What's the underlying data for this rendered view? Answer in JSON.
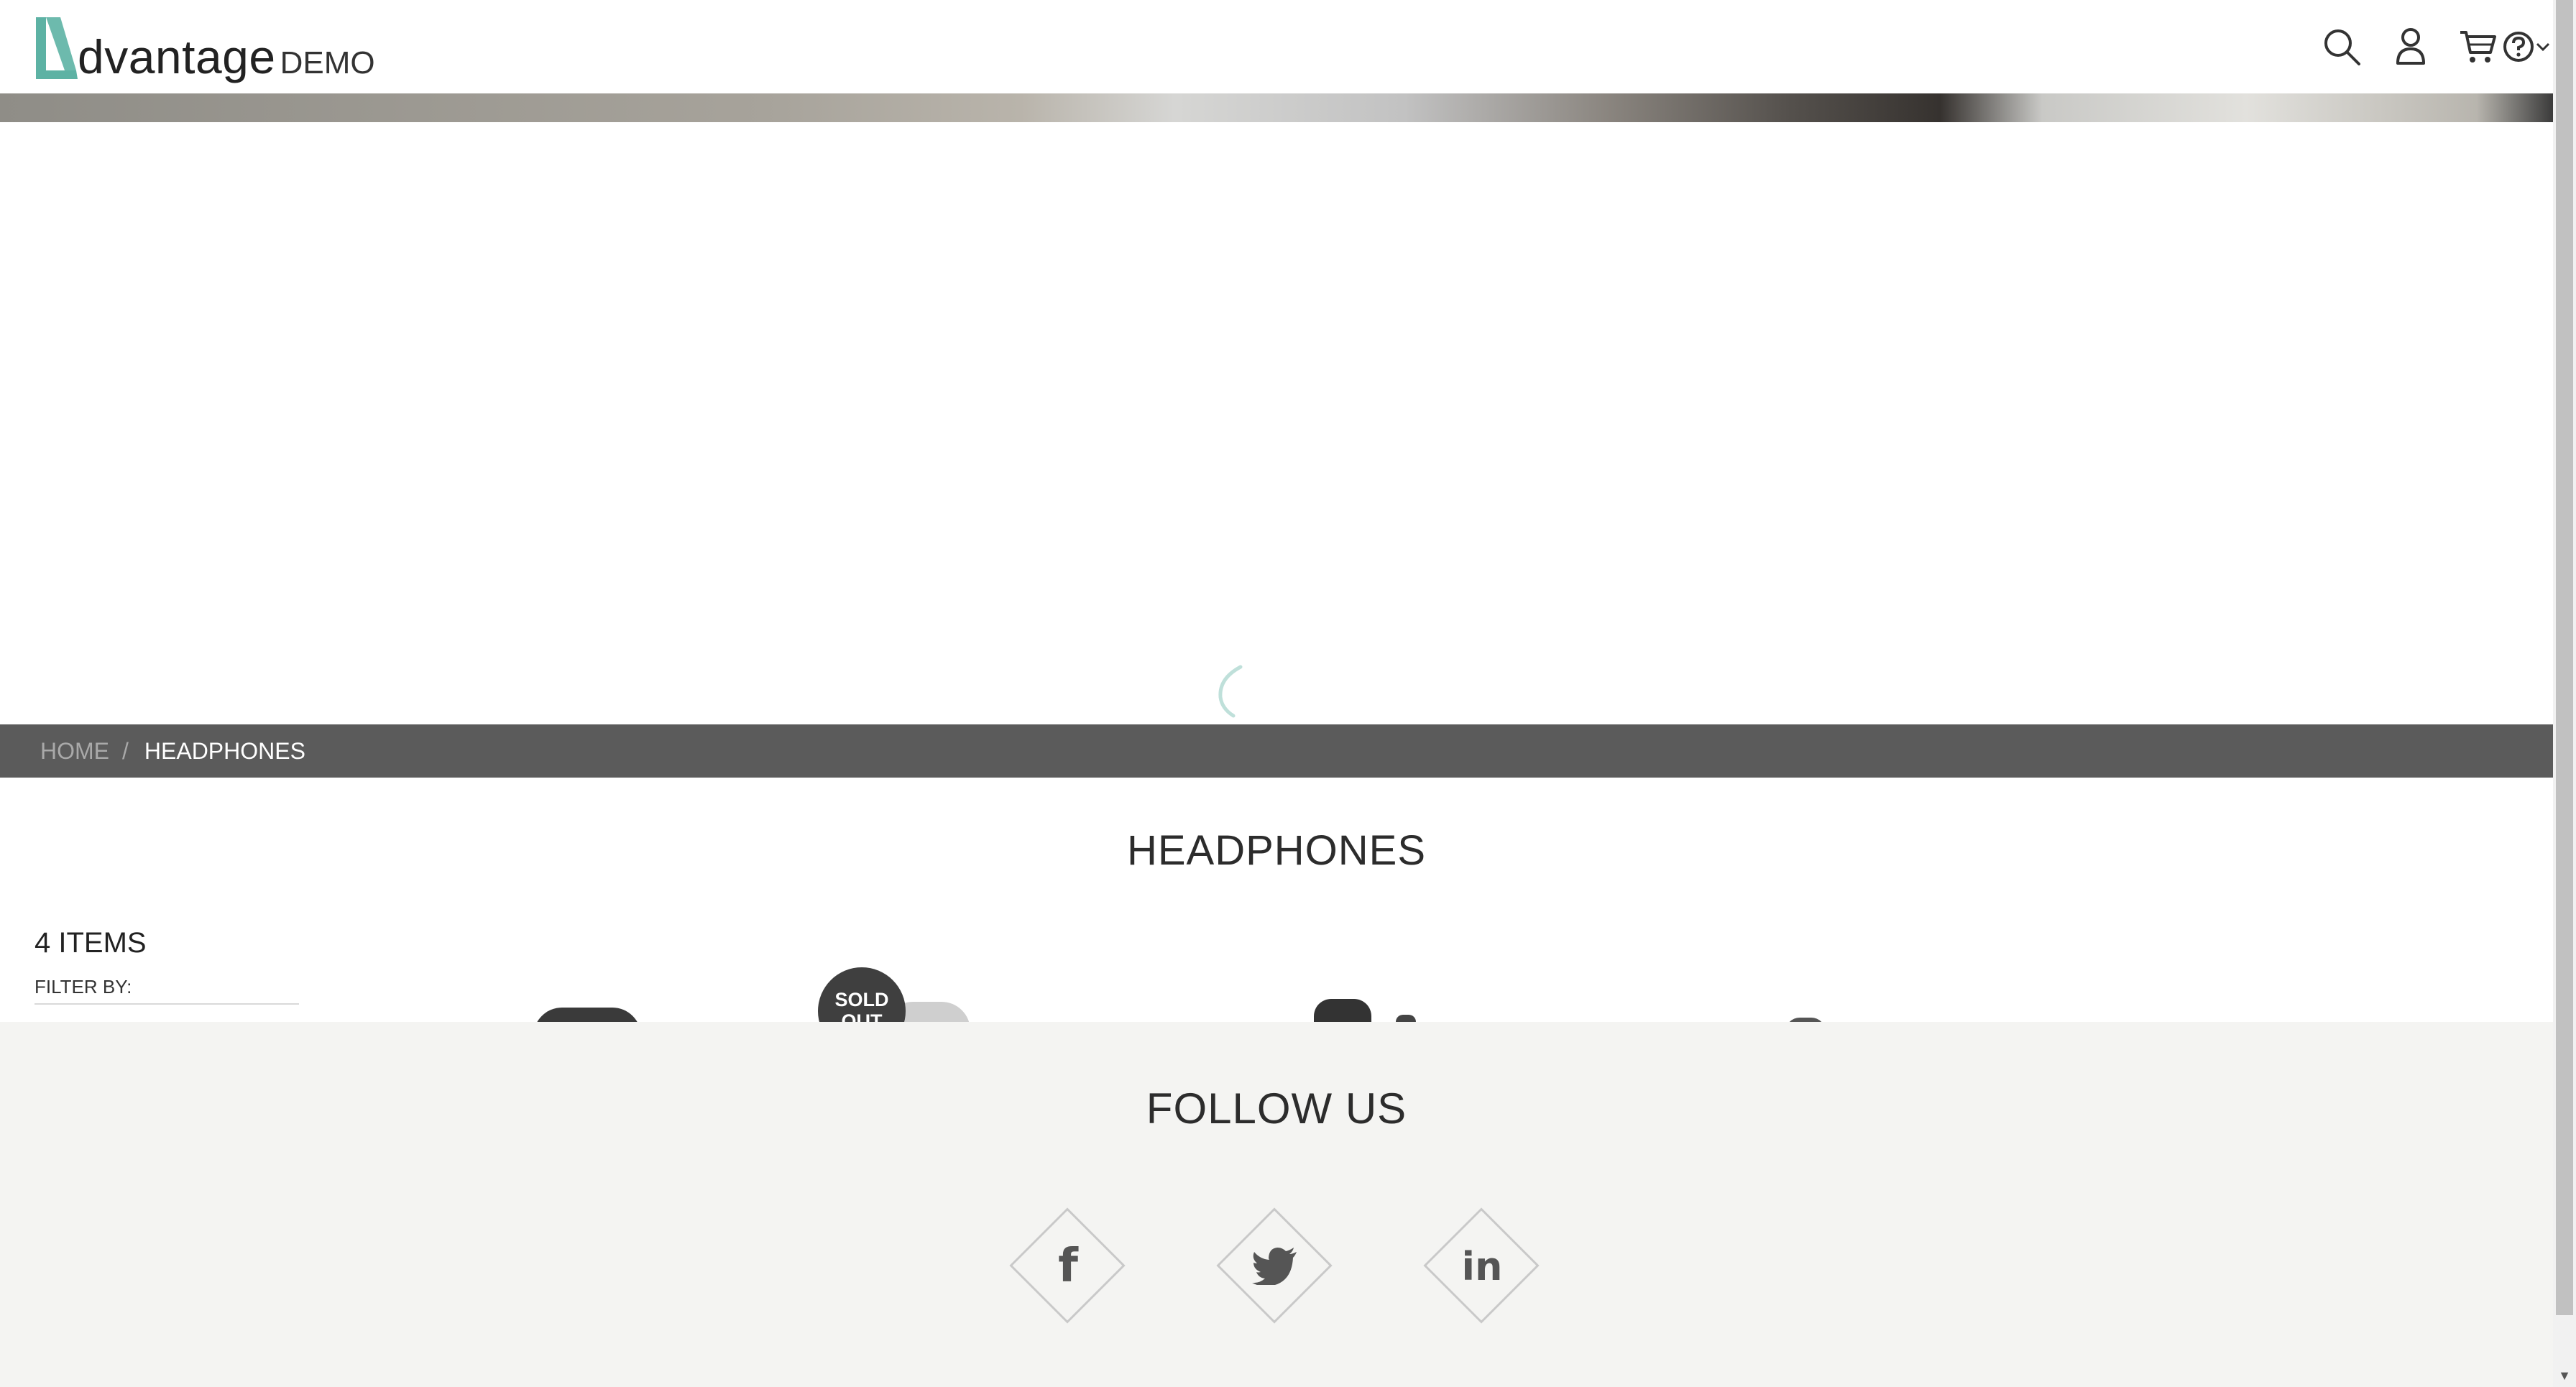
{
  "header": {
    "logo_word": "dvantage",
    "logo_demo": "DEMO",
    "icons": [
      "search-icon",
      "user-icon",
      "cart-icon",
      "help-icon",
      "chevron-down-icon"
    ]
  },
  "breadcrumb": {
    "home": "HOME",
    "separator": "/",
    "current": "HEADPHONES"
  },
  "page_title": "HEADPHONES",
  "sidebar": {
    "items_count": "4 ITEMS",
    "filter_by": "FILTER BY:"
  },
  "products": {
    "sold_out_badge": "SOLD OUT"
  },
  "footer": {
    "follow_us": "FOLLOW US",
    "social": [
      {
        "name": "facebook-icon",
        "glyph": "f"
      },
      {
        "name": "twitter-icon",
        "glyph": ""
      },
      {
        "name": "linkedin-icon",
        "glyph": "in"
      }
    ]
  },
  "colors": {
    "brand_teal": "#5db2a4",
    "breadcrumb_bg": "#5b5b5b",
    "footer_bg": "#f4f4f2"
  }
}
